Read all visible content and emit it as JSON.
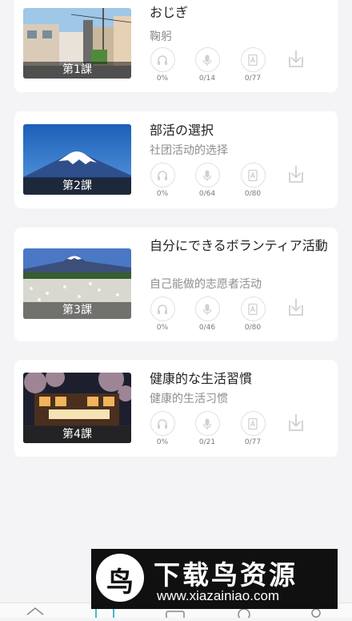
{
  "lessons": [
    {
      "lesson_label": "第1課",
      "title": "おじぎ",
      "subtitle": "鞠躬",
      "listen": "0%",
      "speak": "0/14",
      "words": "0/77"
    },
    {
      "lesson_label": "第2課",
      "title": "部活の選択",
      "subtitle": "社团活动的选择",
      "listen": "0%",
      "speak": "0/64",
      "words": "0/80"
    },
    {
      "lesson_label": "第3課",
      "title": "自分にできるボランティア活動",
      "subtitle": "自己能做的志愿者活动",
      "listen": "0%",
      "speak": "0/46",
      "words": "0/80"
    },
    {
      "lesson_label": "第4課",
      "title": "健康的な生活習慣",
      "subtitle": "健康的生活习惯",
      "listen": "0%",
      "speak": "0/21",
      "words": "0/77"
    }
  ],
  "icons": {
    "listen": "headphones-icon",
    "speak": "microphone-icon",
    "words": "word-card-icon",
    "download": "download-icon"
  },
  "watermark": {
    "brand": "下载鸟资源",
    "url": "www.xiazainiao.com"
  },
  "colors": {
    "background": "#f4f4f6",
    "card": "#ffffff",
    "icon_gray": "#d6d6d6",
    "watermark_bg": "#101010"
  }
}
